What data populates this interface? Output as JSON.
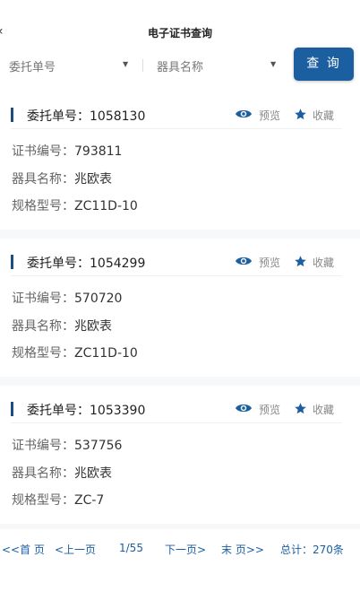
{
  "header": {
    "title": "电子证书查询"
  },
  "filter": {
    "select1": "委托单号",
    "select2": "器具名称",
    "query_label": "查 询"
  },
  "labels": {
    "order": "委托单号：",
    "cert": "证书编号：",
    "name": "器具名称：",
    "model": "规格型号：",
    "preview": "预览",
    "favorite": "收藏"
  },
  "records": [
    {
      "order": "1058130",
      "cert": "793811",
      "name": "兆欧表",
      "model": "ZC11D-10"
    },
    {
      "order": "1054299",
      "cert": "570720",
      "name": "兆欧表",
      "model": "ZC11D-10"
    },
    {
      "order": "1053390",
      "cert": "537756",
      "name": "兆欧表",
      "model": "ZC-7"
    }
  ],
  "pager": {
    "first": "<<首 页",
    "prev": "<上一页",
    "page": "1/55",
    "next": "下一页>",
    "last": "末 页>>",
    "total": "总计：270条"
  },
  "colors": {
    "accent": "#1c5fa1",
    "bar": "#1c4e86"
  }
}
